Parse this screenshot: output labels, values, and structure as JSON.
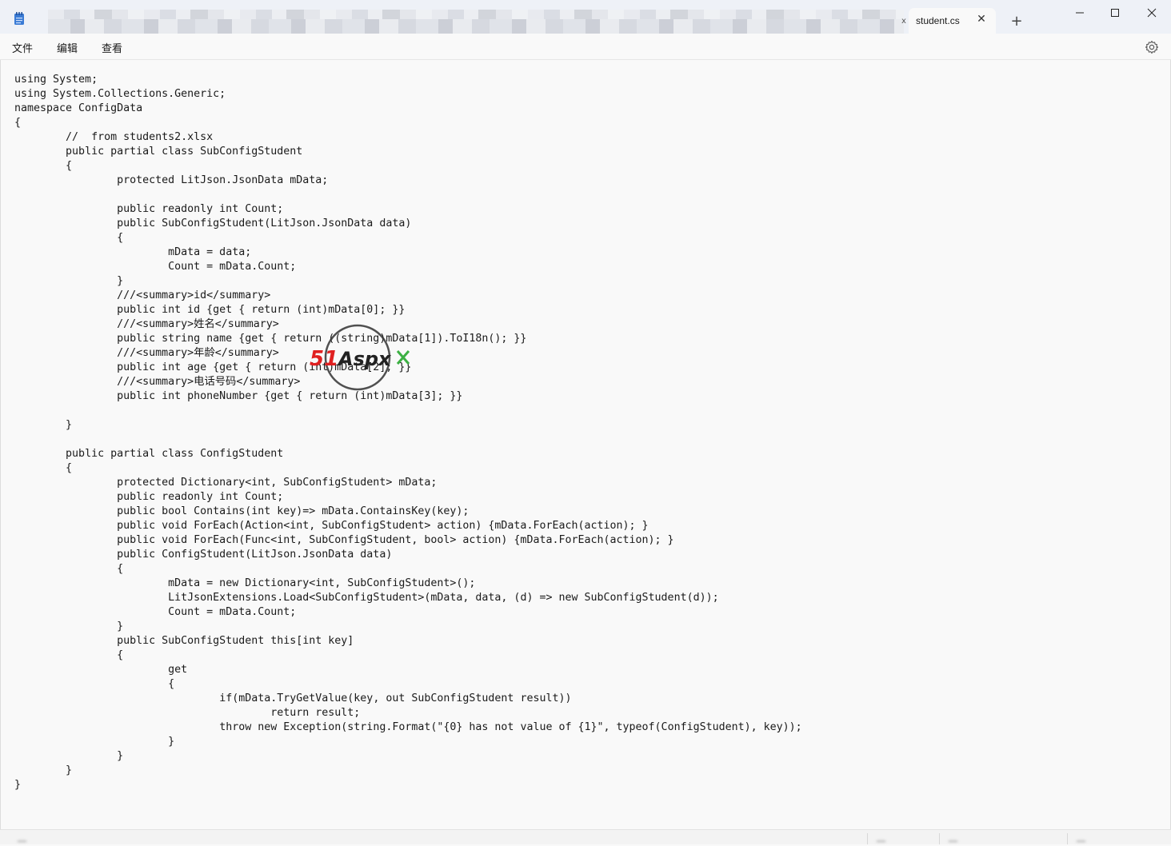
{
  "tabs": {
    "active_label": "student.cs",
    "new_tab_label": "+",
    "close_glyph": "✕",
    "small_close_glyph": "x"
  },
  "window_controls": {
    "minimize": "—",
    "maximize": "☐",
    "close": "✕"
  },
  "menu": {
    "file": "文件",
    "edit": "编辑",
    "view": "查看"
  },
  "editor": {
    "content": "using System;\nusing System.Collections.Generic;\nnamespace ConfigData\n{\n\t//  from students2.xlsx\n\tpublic partial class SubConfigStudent\n\t{\n\t\tprotected LitJson.JsonData mData;\n\n\t\tpublic readonly int Count;\n\t\tpublic SubConfigStudent(LitJson.JsonData data)\n\t\t{\n\t\t\tmData = data;\n\t\t\tCount = mData.Count;\n\t\t}\n\t\t///<summary>id</summary>\n\t\tpublic int id {get { return (int)mData[0]; }}\n\t\t///<summary>姓名</summary>\n\t\tpublic string name {get { return ((string)mData[1]).ToI18n(); }}\n\t\t///<summary>年龄</summary>\n\t\tpublic int age {get { return (int)mData[2]; }}\n\t\t///<summary>电话号码</summary>\n\t\tpublic int phoneNumber {get { return (int)mData[3]; }}\n\n\t}\n\n\tpublic partial class ConfigStudent\n\t{\n\t\tprotected Dictionary<int, SubConfigStudent> mData;\n\t\tpublic readonly int Count;\n\t\tpublic bool Contains(int key)=> mData.ContainsKey(key);\n\t\tpublic void ForEach(Action<int, SubConfigStudent> action) {mData.ForEach(action); }\n\t\tpublic void ForEach(Func<int, SubConfigStudent, bool> action) {mData.ForEach(action); }\n\t\tpublic ConfigStudent(LitJson.JsonData data)\n\t\t{\n\t\t\tmData = new Dictionary<int, SubConfigStudent>();\n\t\t\tLitJsonExtensions.Load<SubConfigStudent>(mData, data, (d) => new SubConfigStudent(d));\n\t\t\tCount = mData.Count;\n\t\t}\n\t\tpublic SubConfigStudent this[int key]\n\t\t{\n\t\t\tget\n\t\t\t{\n\t\t\t\tif(mData.TryGetValue(key, out SubConfigStudent result))\n\t\t\t\t\treturn result;\n\t\t\t\tthrow new Exception(string.Format(\"{0} has not value of {1}\", typeof(ConfigStudent), key));\n\t\t\t}\n\t\t}\n\t}\n}"
  },
  "watermark": {
    "text_red": "51",
    "text_dark": "Aspx",
    "color_red": "#e02020",
    "color_dark": "#222222"
  },
  "icons": {
    "app": "notepad-icon",
    "settings": "gear-icon"
  },
  "colors": {
    "titlebar": "#eef1f7",
    "editor_bg": "#f9f9f9"
  }
}
